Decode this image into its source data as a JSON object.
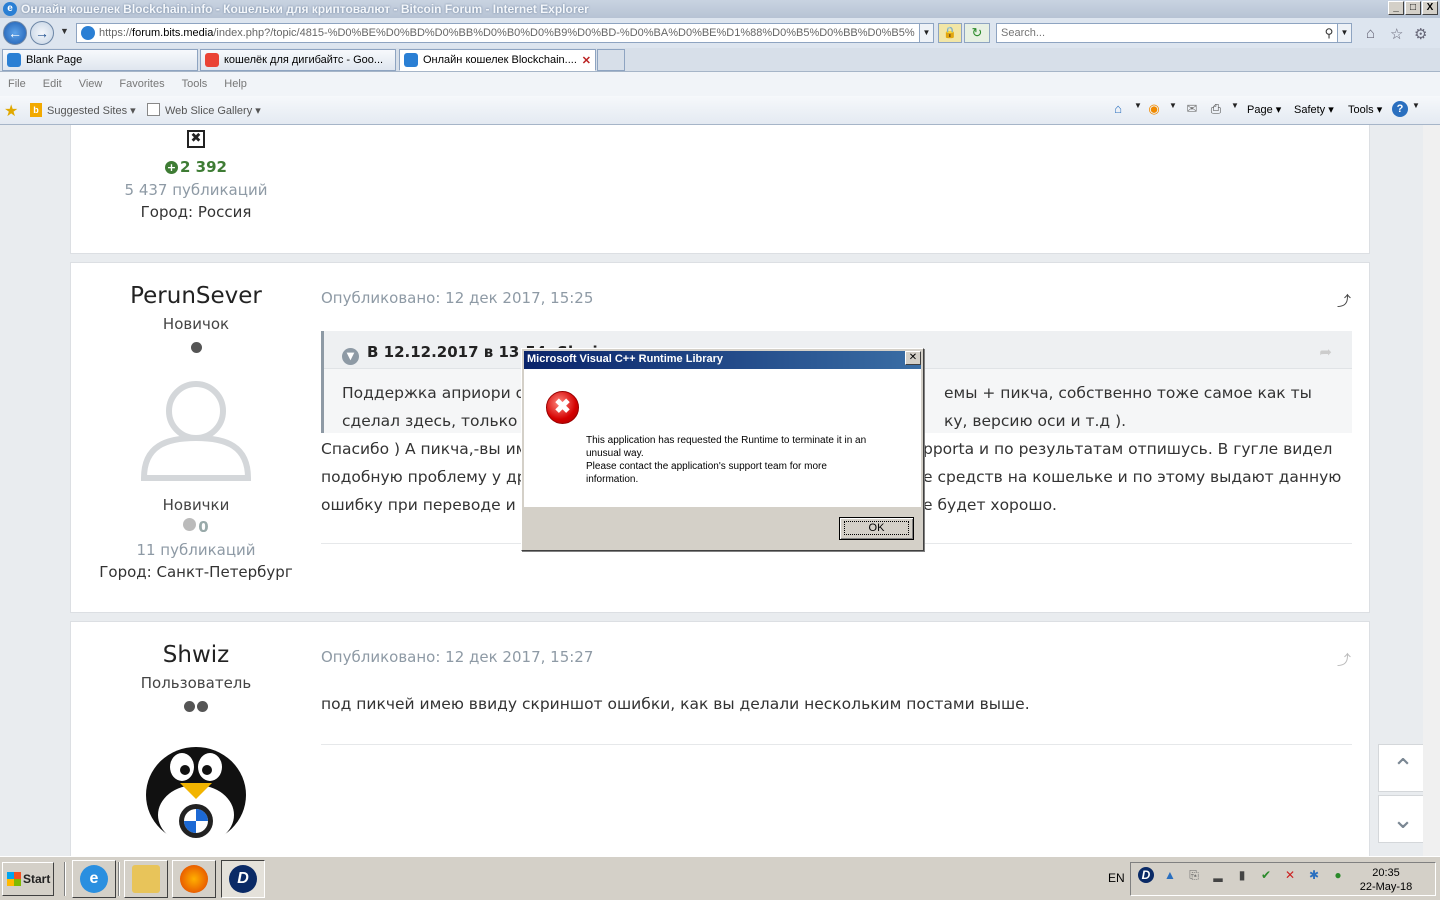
{
  "window": {
    "title": "Онлайн кошелек Blockchain.info - Кошельки для криптовалют - Bitcoin Forum - Internet Explorer",
    "buttons": [
      "_",
      "□",
      "X"
    ]
  },
  "address_bar": {
    "url_prefix": "https://",
    "url_host": "forum.bits.media",
    "url_path": "/index.php?/topic/4815-%D0%BE%D0%BD%D0%BB%D0%B0%D0%B9%D0%BD-%D0%BA%D0%BE%D1%88%D0%B5%D0%BB%D0%B5%",
    "search_placeholder": "Search..."
  },
  "tabs": [
    {
      "label": "Blank Page",
      "color": "#2a7fd4"
    },
    {
      "label": "кошелёк для дигибайтс - Goo...",
      "color": "#ea4335"
    },
    {
      "label": "Онлайн кошелек Blockchain....",
      "color": "#2a7fd4",
      "active": true
    }
  ],
  "menu": [
    "File",
    "Edit",
    "View",
    "Favorites",
    "Tools",
    "Help"
  ],
  "favorites_bar": {
    "suggested": "Suggested Sites ▾",
    "webslice": "Web Slice Gallery ▾",
    "commands": [
      "Page ▾",
      "Safety ▾",
      "Tools ▾"
    ]
  },
  "posts": [
    {
      "reputation": "2 392",
      "publications": "5 437 публикаций",
      "city": "Город: Россия"
    },
    {
      "username": "PerunSever",
      "rank": "Новичок",
      "group": "Новички",
      "reputation": "0",
      "publications": "11 публикаций",
      "city": "Город: Санкт-Петербург",
      "timestamp": "Опубликовано: 12 дек 2017, 15:25",
      "quote_header": "В 12.12.2017 в 13:54, Shwiz",
      "quote_line1": "Поддержка априори от",
      "quote_line1_tail": "емы + пикча, собственно тоже самое как ты",
      "quote_line2": "сделал здесь, только е",
      "quote_line2_tail": "ку, версию оси и т.д ).",
      "text_line1": "Спасибо ) А пикча,-вы им",
      "text_line1_tail": "pporta и по результатам отпишусь. В гугле видел",
      "text_line2": "подобную проблему у др",
      "text_line2_tail": "е средств на кошельке и по этому выдают данную",
      "text_line3": "ошибку при переводе и ч",
      "text_line3_tail": "е будет хорошо."
    },
    {
      "username": "Shwiz",
      "rank": "Пользователь",
      "timestamp": "Опубликовано: 12 дек 2017, 15:27",
      "text": "под пикчей имею ввиду скриншот ошибки, как вы делали нескольким постами выше."
    }
  ],
  "dialog": {
    "title": "Microsoft Visual C++ Runtime Library",
    "message_line1": "This application has requested the Runtime to terminate it in an",
    "message_line2": "unusual way.",
    "message_line3": "Please contact the application's support team for more",
    "message_line4": "information.",
    "ok_label": "OK"
  },
  "taskbar": {
    "start_label": "Start",
    "language": "EN",
    "time": "20:35",
    "date": "22-May-18"
  },
  "colors": {
    "accent": "#3e7c34",
    "titlebar": "#0a246a",
    "error": "#d40000"
  }
}
